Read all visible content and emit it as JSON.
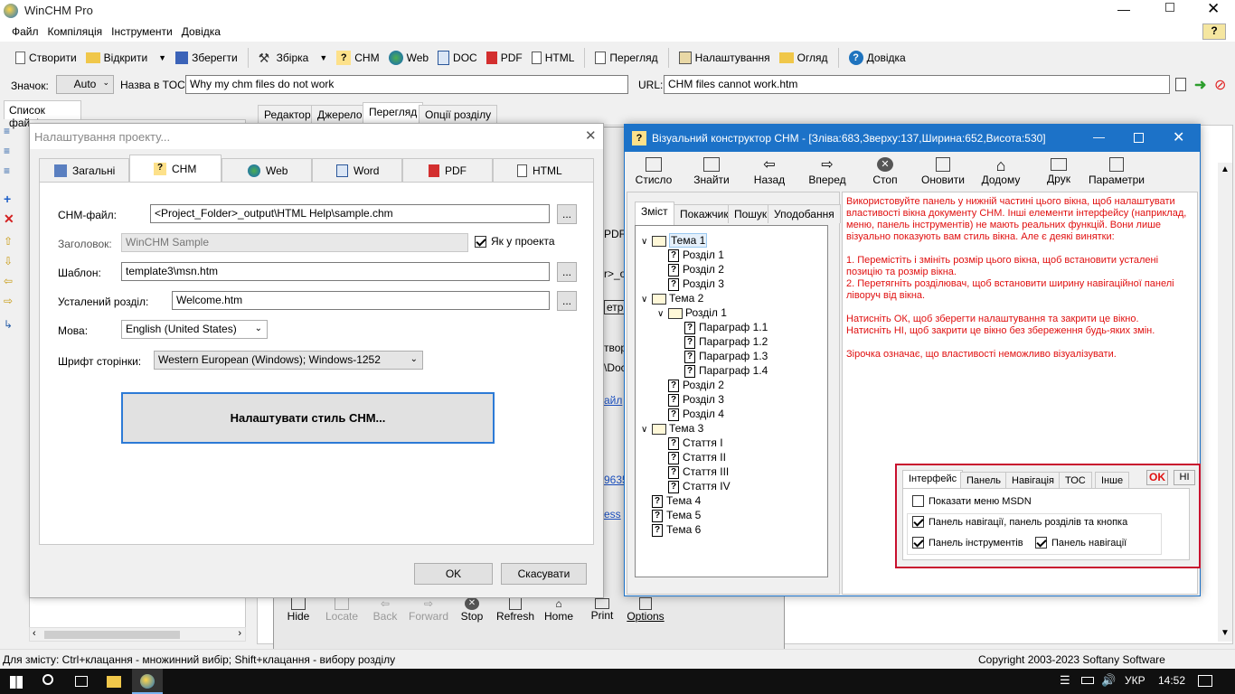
{
  "app": {
    "title": "WinCHM Pro"
  },
  "menu": [
    "Файл",
    "Компіляція",
    "Інструменти",
    "Довідка"
  ],
  "toolbar": {
    "create": "Створити",
    "open": "Відкрити",
    "save": "Зберегти",
    "build": "Збірка",
    "chm": "CHM",
    "web": "Web",
    "doc": "DOC",
    "pdf": "PDF",
    "html": "HTML",
    "preview": "Перегляд",
    "settings": "Налаштування",
    "overview": "Огляд",
    "help": "Довідка"
  },
  "props": {
    "icon_label": "Значок:",
    "icon_value": "Auto",
    "toc_label": "Назва в TOC:",
    "toc_value": "Why my chm files do not work",
    "url_label": "URL:",
    "url_value": "CHM files cannot work.htm"
  },
  "left_panel": {
    "tab": "Список файлів"
  },
  "editor_tabs": [
    "Редактор",
    "Джерело",
    "Перегляд",
    "Опції розділу"
  ],
  "behind": {
    "pdf": "PDF",
    "r_o": "r>_o",
    "etri": "етри",
    "tvor": "твор",
    "doc": "\\Doc",
    "fail": "айл",
    "n635": "9635",
    "ess": "ess"
  },
  "preview_toolbar": [
    "Hide",
    "Locate",
    "Back",
    "Forward",
    "Stop",
    "Refresh",
    "Home",
    "Print",
    "Options"
  ],
  "project_dialog": {
    "title": "Налаштування проекту...",
    "tabs": [
      "Загальні",
      "CHM",
      "Web",
      "Word",
      "PDF",
      "HTML"
    ],
    "chm_file_label": "CHM-файл:",
    "chm_file_value": "<Project_Folder>_output\\HTML Help\\sample.chm",
    "title_label": "Заголовок:",
    "title_value": "WinCHM Sample",
    "same_as_project": "Як у проекта",
    "template_label": "Шаблон:",
    "template_value": "template3\\msn.htm",
    "default_label": "Усталений розділ:",
    "default_value": "Welcome.htm",
    "lang_label": "Мова:",
    "lang_value": "English (United States)",
    "font_label": "Шрифт сторінки:",
    "font_value": "Western European (Windows); Windows-1252",
    "style_button": "Налаштувати стиль CHM...",
    "ok": "OK",
    "cancel": "Скасувати",
    "browse": "..."
  },
  "visual_dialog": {
    "title": "Візуальний конструктор CHM - [Зліва:683,Зверху:137,Ширина:652,Висота:530]",
    "toolbar": [
      "Стисло",
      "Знайти",
      "Назад",
      "Вперед",
      "Стоп",
      "Оновити",
      "Додому",
      "Друк",
      "Параметри"
    ],
    "nav_tabs": [
      "Зміст",
      "Покажчик",
      "Пошук",
      "Уподобання"
    ],
    "tree": [
      {
        "t": "Тема 1",
        "lvl": 0,
        "book": true,
        "exp": true,
        "sel": true
      },
      {
        "t": "Розділ 1",
        "lvl": 1
      },
      {
        "t": "Розділ 2",
        "lvl": 1
      },
      {
        "t": "Розділ 3",
        "lvl": 1
      },
      {
        "t": "Тема 2",
        "lvl": 0,
        "book": true,
        "exp": true
      },
      {
        "t": "Розділ 1",
        "lvl": 1,
        "book": true,
        "exp": true
      },
      {
        "t": "Параграф 1.1",
        "lvl": 2
      },
      {
        "t": "Параграф 1.2",
        "lvl": 2
      },
      {
        "t": "Параграф 1.3",
        "lvl": 2
      },
      {
        "t": "Параграф 1.4",
        "lvl": 2
      },
      {
        "t": "Розділ 2",
        "lvl": 1
      },
      {
        "t": "Розділ 3",
        "lvl": 1
      },
      {
        "t": "Розділ 4",
        "lvl": 1
      },
      {
        "t": "Тема 3",
        "lvl": 0,
        "book": true,
        "exp": true
      },
      {
        "t": "Стаття I",
        "lvl": 1
      },
      {
        "t": "Стаття II",
        "lvl": 1
      },
      {
        "t": "Стаття III",
        "lvl": 1
      },
      {
        "t": "Стаття IV",
        "lvl": 1
      },
      {
        "t": "Тема 4",
        "lvl": 0
      },
      {
        "t": "Тема 5",
        "lvl": 0
      },
      {
        "t": "Тема 6",
        "lvl": 0
      }
    ],
    "info": [
      "Використовуйте панель у нижній частині цього вікна, щоб налаштувати властивості вікна документу CHM. Інші елементи інтерфейсу (наприклад, меню, панель інструментів) не мають реальних функцій. Вони лише візуально показують вам стиль вікна. Але є деякі винятки:",
      "",
      "1. Перемістіть і змініть розмір цього вікна, щоб встановити усталені позицію та розмір вікна.",
      "2. Перетягніть розділювач, щоб встановити ширину навігаційної панелі ліворуч від вікна.",
      "",
      "Натисніть ОК, щоб зберегти налаштування та закрити це вікно.",
      "Натисніть НІ, щоб закрити це вікно без збереження будь-яких змін.",
      "",
      "Зірочка означає, що властивості неможливо візуалізувати."
    ],
    "settings_tabs": [
      "Інтерфейс",
      "Панель",
      "Навігація",
      "ТОС",
      "Інше"
    ],
    "ok": "OK",
    "no": "НІ",
    "opt_msdn": "Показати меню MSDN",
    "opt_nav": "Панель навігації, панель розділів та кнопка",
    "opt_toolbar": "Панель інструментів",
    "opt_navpanel": "Панель навігації"
  },
  "status": {
    "left": "Для змісту: Ctrl+клацання - множинний вибір; Shift+клацання - вибору розділу",
    "right": "Copyright 2003-2023 Softany Software"
  },
  "taskbar": {
    "lang": "УКР",
    "time": "14:52"
  }
}
